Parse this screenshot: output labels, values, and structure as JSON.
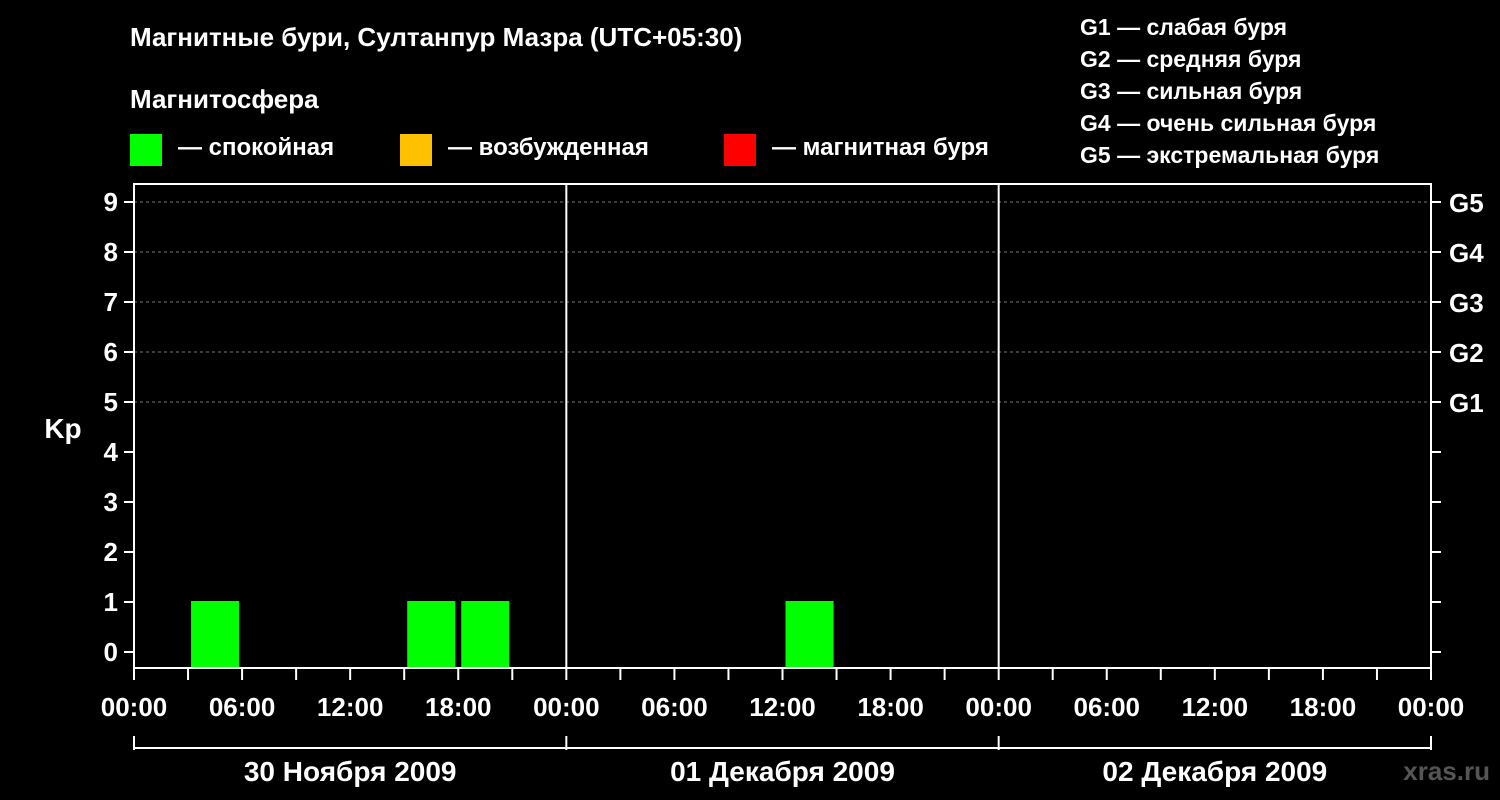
{
  "chart_data": {
    "type": "bar",
    "title": "Магнитные бури, Султанпур Мазра (UTC+05:30)",
    "subtitle": "Магнитосфера",
    "ylabel": "Kp",
    "ylim": [
      0,
      9
    ],
    "y_ticks": [
      "0",
      "1",
      "2",
      "3",
      "4",
      "5",
      "6",
      "7",
      "8",
      "9"
    ],
    "right_axis": [
      {
        "kp": 5,
        "label": "G1"
      },
      {
        "kp": 6,
        "label": "G2"
      },
      {
        "kp": 7,
        "label": "G3"
      },
      {
        "kp": 8,
        "label": "G4"
      },
      {
        "kp": 9,
        "label": "G5"
      }
    ],
    "x_tick_labels": [
      "00:00",
      "06:00",
      "12:00",
      "18:00",
      "00:00",
      "06:00",
      "12:00",
      "18:00",
      "00:00",
      "06:00",
      "12:00",
      "18:00",
      "00:00"
    ],
    "days": [
      "30 Ноября 2009",
      "01 Декабря 2009",
      "02 Декабря 2009"
    ],
    "grid": true,
    "bars": [
      {
        "day": 0,
        "start_hour": 3,
        "value": 1,
        "status": "quiet"
      },
      {
        "day": 0,
        "start_hour": 15,
        "value": 1,
        "status": "quiet"
      },
      {
        "day": 0,
        "start_hour": 18,
        "value": 1,
        "status": "quiet"
      },
      {
        "day": 1,
        "start_hour": 12,
        "value": 1,
        "status": "quiet"
      }
    ]
  },
  "legend": {
    "items": [
      {
        "key": "quiet",
        "label": "— спокойная",
        "color": "#00ff00"
      },
      {
        "key": "active",
        "label": "— возбужденная",
        "color": "#ffc000"
      },
      {
        "key": "storm",
        "label": "— магнитная буря",
        "color": "#ff0000"
      }
    ]
  },
  "g_legend": [
    "G1 — слабая буря",
    "G2 — средняя буря",
    "G3 — сильная буря",
    "G4 — очень сильная буря",
    "G5 — экстремальная буря"
  ],
  "watermark": "xras.ru"
}
